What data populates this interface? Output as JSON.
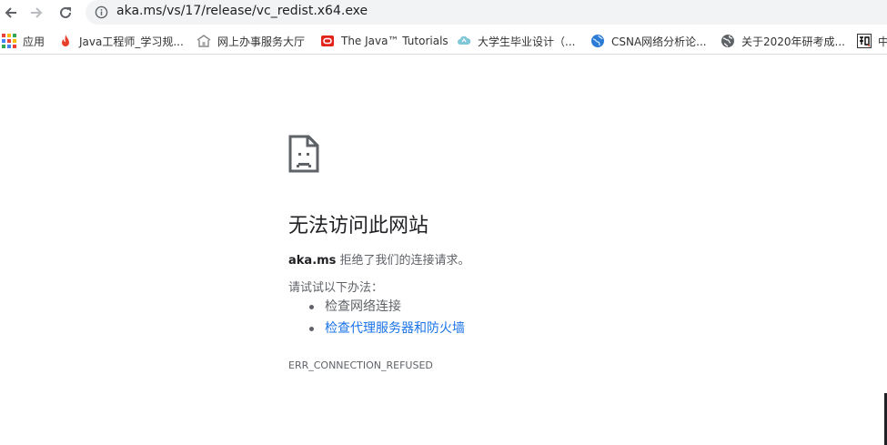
{
  "toolbar": {
    "url": "aka.ms/vs/17/release/vc_redist.x64.exe"
  },
  "bookmarks": [
    {
      "label": "应用",
      "icon": "apps-grid-icon"
    },
    {
      "label": "Java工程师_学习规...",
      "icon": "flame-icon"
    },
    {
      "label": "网上办事服务大厅",
      "icon": "government-icon"
    },
    {
      "label": "The Java™ Tutorials",
      "icon": "oracle-icon"
    },
    {
      "label": "大学生毕业设计（...",
      "icon": "cloud-icon"
    },
    {
      "label": "CSNA网络分析论...",
      "icon": "globe-blue-icon"
    },
    {
      "label": "关于2020年研考成...",
      "icon": "globe-icon"
    },
    {
      "label": "中",
      "icon": "zhihu-icon"
    }
  ],
  "error": {
    "title": "无法访问此网站",
    "host": "aka.ms",
    "message": " 拒绝了我们的连接请求。",
    "try_label": "请试试以下办法：",
    "suggestion_1": "检查网络连接",
    "suggestion_2": "检查代理服务器和防火墙",
    "code": "ERR_CONNECTION_REFUSED"
  },
  "colors": {
    "link": "#1a73e8",
    "text": "#202124",
    "secondary_text": "#5f6368",
    "omnibox_bg": "#f1f3f4"
  }
}
